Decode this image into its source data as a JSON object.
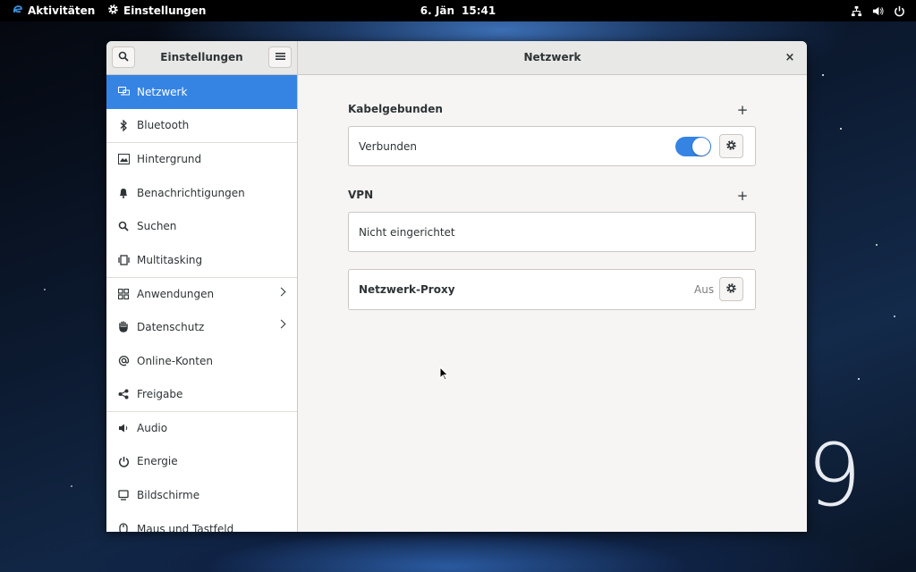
{
  "topbar": {
    "activities": "Aktivitäten",
    "app_name": "Einstellungen",
    "date": "6. Jän",
    "time": "15:41"
  },
  "desktop": {
    "logo_text": "9"
  },
  "window": {
    "sidebar_title": "Einstellungen",
    "page_title": "Netzwerk",
    "close_glyph": "×"
  },
  "sidebar": {
    "items": [
      {
        "label": "Netzwerk",
        "icon": "network-icon",
        "active": true
      },
      {
        "label": "Bluetooth",
        "icon": "bluetooth-icon"
      },
      {
        "label": "Hintergrund",
        "icon": "background-icon"
      },
      {
        "label": "Benachrichtigungen",
        "icon": "bell-icon"
      },
      {
        "label": "Suchen",
        "icon": "search-icon"
      },
      {
        "label": "Multitasking",
        "icon": "multitasking-icon"
      },
      {
        "label": "Anwendungen",
        "icon": "apps-icon",
        "has_submenu": true
      },
      {
        "label": "Datenschutz",
        "icon": "hand-icon",
        "has_submenu": true
      },
      {
        "label": "Online-Konten",
        "icon": "at-icon"
      },
      {
        "label": "Freigabe",
        "icon": "share-icon"
      },
      {
        "label": "Audio",
        "icon": "speaker-icon"
      },
      {
        "label": "Energie",
        "icon": "power-icon"
      },
      {
        "label": "Bildschirme",
        "icon": "display-icon"
      },
      {
        "label": "Maus und Tastfeld",
        "icon": "mouse-icon"
      }
    ]
  },
  "network": {
    "wired": {
      "title": "Kabelgebunden",
      "add_glyph": "+",
      "status": "Verbunden",
      "enabled": true
    },
    "vpn": {
      "title": "VPN",
      "add_glyph": "+",
      "status": "Nicht eingerichtet"
    },
    "proxy": {
      "title": "Netzwerk-Proxy",
      "status": "Aus"
    }
  },
  "colors": {
    "accent": "#3584e4",
    "sidebar_bg": "#ffffff",
    "content_bg": "#f6f5f4"
  }
}
